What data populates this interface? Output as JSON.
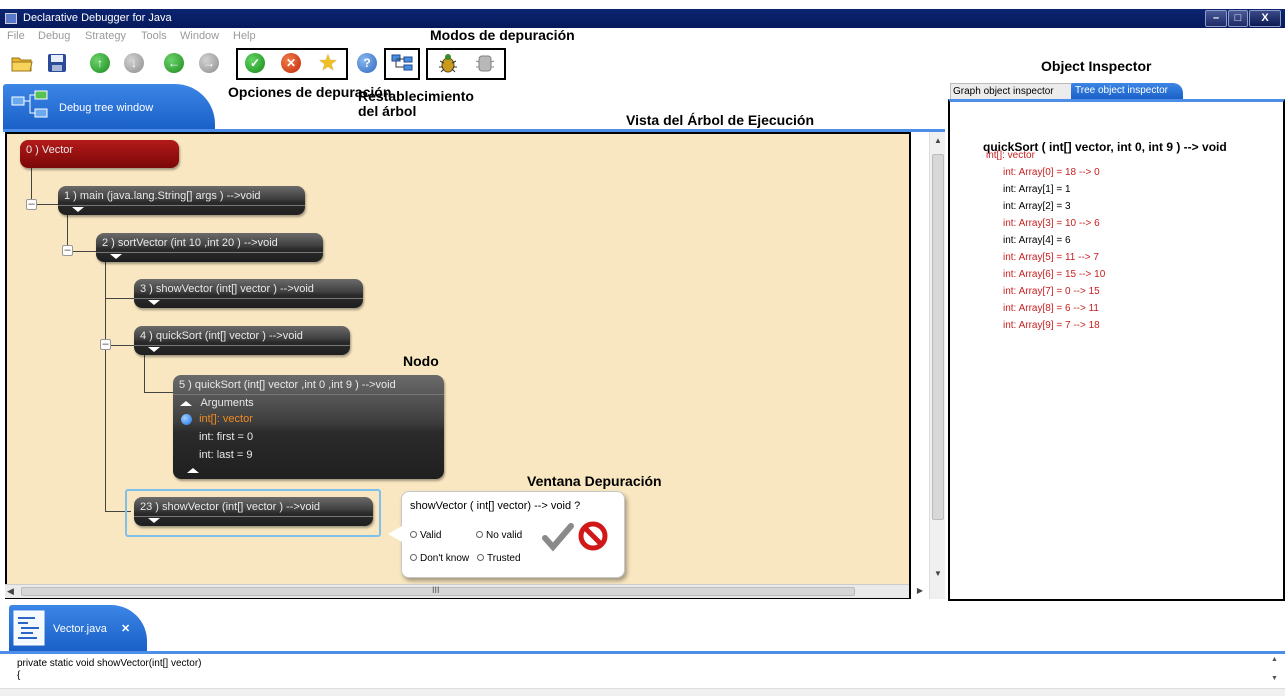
{
  "window": {
    "title": "Declarative Debugger for Java",
    "controls": [
      "–",
      "□",
      "X"
    ]
  },
  "menu": [
    "File",
    "Debug",
    "Strategy",
    "Tools",
    "Window",
    "Help"
  ],
  "annotations": {
    "debug_modes": "Modos de depuración",
    "debug_options": "Opciones de depuración",
    "tree_reset": "Restablecimiento del árbol",
    "tree_view": "Vista del Árbol de Ejecución",
    "node": "Nodo",
    "debug_window": "Ventana Depuración",
    "object_inspector": "Object Inspector"
  },
  "debug_tab": {
    "label": "Debug tree window"
  },
  "tree": {
    "nodes": [
      {
        "label": "0 ) Vector"
      },
      {
        "label": "1 )  main (java.lang.String[] args  ) -->void"
      },
      {
        "label": "2 )  sortVector (int 10 ,int 20  ) -->void"
      },
      {
        "label": "3 )  showVector (int[] vector  ) -->void"
      },
      {
        "label": "4 )  quickSort (int[] vector  ) -->void"
      },
      {
        "label": "5 )  quickSort (int[] vector ,int 0 ,int 9  ) -->void"
      },
      {
        "label": "23 )  showVector (int[] vector  ) -->void"
      }
    ],
    "expanded": {
      "section": "Arguments",
      "args": [
        "int[]: vector",
        "int: first = 0",
        "int: last = 9"
      ]
    },
    "hscroll_label": "III"
  },
  "popup": {
    "question": "showVector ( int[] vector) --> void ?",
    "options": [
      "Valid",
      "No valid",
      "Don't know",
      "Trusted"
    ]
  },
  "inspector": {
    "tabs": [
      "Graph object inspector",
      "Tree object inspector"
    ],
    "method": "quickSort ( int[] vector, int 0, int 9 ) --> void",
    "lines": [
      {
        "text": "int[]: vector",
        "changed": true
      },
      {
        "text": "int: Array[0] = 18 --> 0",
        "changed": true
      },
      {
        "text": "int: Array[1] = 1",
        "changed": false
      },
      {
        "text": "int: Array[2] = 3",
        "changed": false
      },
      {
        "text": "int: Array[3] = 10 --> 6",
        "changed": true
      },
      {
        "text": "int: Array[4] = 6",
        "changed": false
      },
      {
        "text": "int: Array[5] = 11 --> 7",
        "changed": true
      },
      {
        "text": "int: Array[6] = 15 --> 10",
        "changed": true
      },
      {
        "text": "int: Array[7] = 0 --> 15",
        "changed": true
      },
      {
        "text": "int: Array[8] = 6 --> 11",
        "changed": true
      },
      {
        "text": "int: Array[9] = 7 --> 18",
        "changed": true
      }
    ]
  },
  "source_tab": {
    "label": "Vector.java",
    "close": "✕"
  },
  "code": [
    "private static void showVector(int[] vector)",
    "{"
  ],
  "colors": {
    "accent_blue": "#1a60c8",
    "tree_bg": "#f9e7c1",
    "changed_value": "#c62020",
    "root_node": "#8b0a0a"
  },
  "icons": [
    "open-folder-icon",
    "save-icon",
    "up-icon",
    "down-icon",
    "back-icon",
    "forward-icon",
    "valid-icon",
    "invalid-icon",
    "trusted-star-icon",
    "help-icon",
    "tree-reset-icon",
    "bug-mode-icon",
    "ghost-bug-mode-icon"
  ]
}
